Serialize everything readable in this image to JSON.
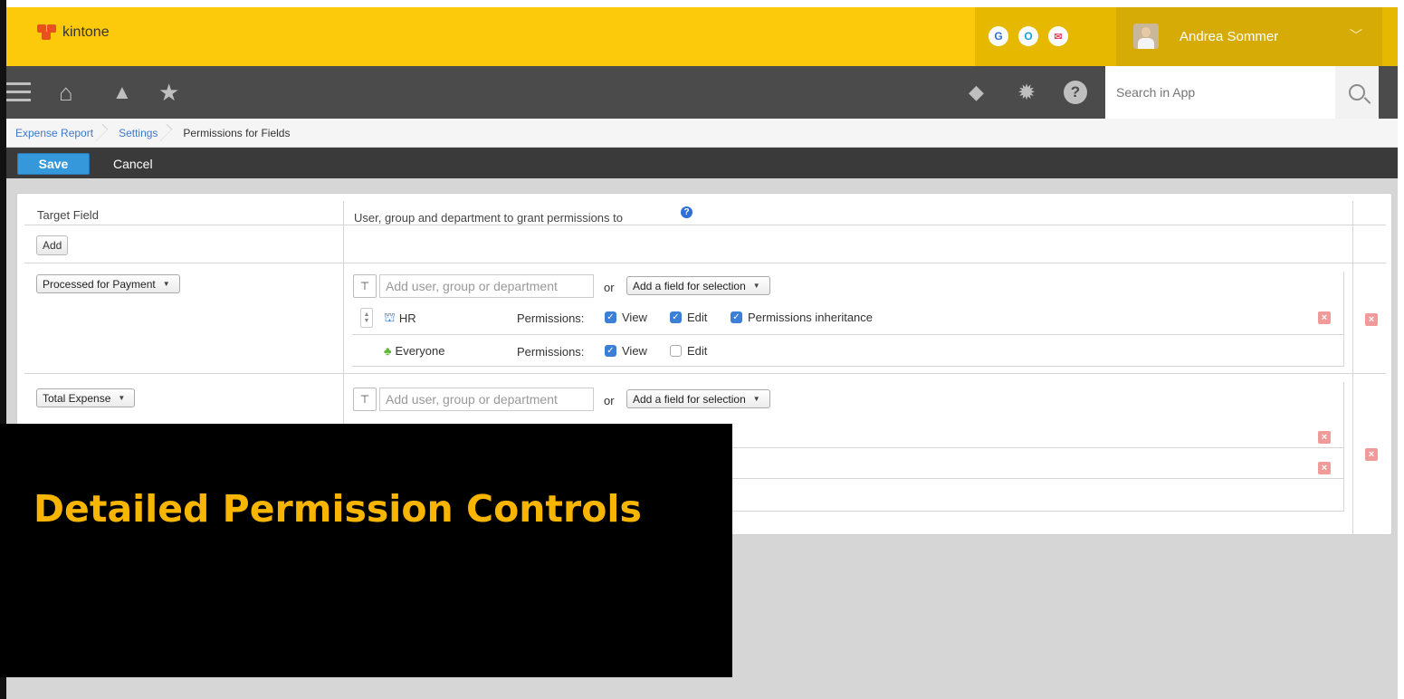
{
  "brand": {
    "name": "kintone",
    "accent": "#fcca0a",
    "logo_color": "#e6511c"
  },
  "header": {
    "services": [
      {
        "icon": "garoon-g-icon",
        "glyph": "G",
        "color": "#2f6fd8"
      },
      {
        "icon": "office-o-icon",
        "glyph": "O",
        "color": "#1aa0dc"
      },
      {
        "icon": "mail-icon",
        "glyph": "✉",
        "color": "#e94b6b"
      }
    ],
    "user_name": "Andrea Sommer",
    "user_menu_glyph": "﹀"
  },
  "navbar": {
    "icons": [
      "menu-icon",
      "home-icon",
      "bell-icon",
      "star-icon"
    ],
    "right_icons": [
      "guide-cap-icon",
      "gear-icon",
      "help-icon"
    ],
    "search": {
      "placeholder": "Search in App",
      "value": ""
    }
  },
  "breadcrumb": [
    "Expense Report",
    "Settings",
    "Permissions for Fields"
  ],
  "actions": {
    "save_label": "Save",
    "cancel_label": "Cancel"
  },
  "table": {
    "col_target": "Target Field",
    "col_grant": "User, group and department to grant permissions to",
    "add_label": "Add",
    "entity_placeholder": "Add user, group or department",
    "or_label": "or",
    "field_select_label": "Add a field for selection",
    "permissions_label": "Permissions:",
    "rows": [
      {
        "field": "Processed for Payment",
        "entries": [
          {
            "name": "HR",
            "icon": "department-icon",
            "view": {
              "label": "View",
              "checked": true
            },
            "edit": {
              "label": "Edit",
              "checked": true
            },
            "inherit": {
              "label": "Permissions inheritance",
              "checked": true
            }
          },
          {
            "name": "Everyone",
            "icon": "everyone-group-icon",
            "view": {
              "label": "View",
              "checked": true
            },
            "edit": {
              "label": "Edit",
              "checked": false
            }
          }
        ]
      },
      {
        "field": "Total Expense"
      }
    ]
  },
  "caption": {
    "text": "Detailed Permission Controls"
  }
}
